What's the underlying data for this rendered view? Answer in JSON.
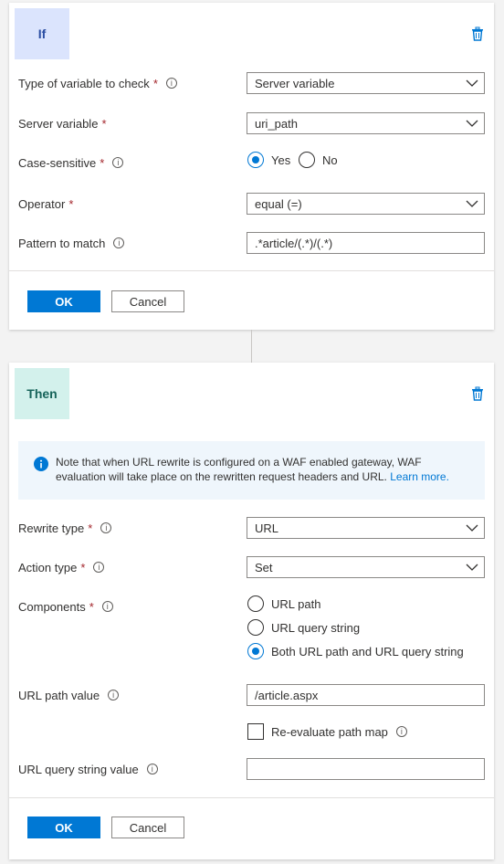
{
  "if_card": {
    "badge": "If",
    "delete_icon": "trash-icon",
    "fields": {
      "variable_type": {
        "label": "Type of variable to check",
        "value": "Server variable"
      },
      "server_variable": {
        "label": "Server variable",
        "value": "uri_path"
      },
      "case_sensitive": {
        "label": "Case-sensitive",
        "options": [
          "Yes",
          "No"
        ],
        "selected": "Yes"
      },
      "operator": {
        "label": "Operator",
        "value": "equal (=)"
      },
      "pattern": {
        "label": "Pattern to match",
        "value": ".*article/(.*)/(.*)"
      }
    },
    "ok_label": "OK",
    "cancel_label": "Cancel"
  },
  "then_card": {
    "badge": "Then",
    "delete_icon": "trash-icon",
    "notice": {
      "icon": "info-filled-icon",
      "text": "Note that when URL rewrite is configured on a WAF enabled gateway, WAF evaluation will take place on the rewritten request headers and URL.",
      "link": "Learn more."
    },
    "fields": {
      "rewrite_type": {
        "label": "Rewrite type",
        "value": "URL"
      },
      "action_type": {
        "label": "Action type",
        "value": "Set"
      },
      "components": {
        "label": "Components",
        "options": [
          "URL path",
          "URL query string",
          "Both URL path and URL query string"
        ],
        "selected": "Both URL path and URL query string"
      },
      "url_path_value": {
        "label": "URL path value",
        "value": "/article.aspx"
      },
      "reevaluate": {
        "label": "Re-evaluate path map",
        "checked": false
      },
      "query_string_value": {
        "label": "URL query string value",
        "value": ""
      }
    },
    "ok_label": "OK",
    "cancel_label": "Cancel"
  },
  "colors": {
    "primary": "#0078d4",
    "required": "#a4262c",
    "if_badge_bg": "#dbe4fd",
    "then_badge_bg": "#d3f1ec",
    "notice_bg": "#eff6fc"
  }
}
